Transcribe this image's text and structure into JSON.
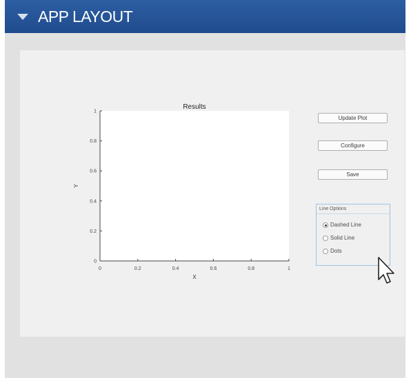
{
  "header": {
    "title": "APP LAYOUT",
    "background_color": "#1f4c8d",
    "collapse_icon": "triangle-down-icon"
  },
  "plot": {
    "title": "Results",
    "xlabel": "X",
    "ylabel": "Y",
    "xticks": [
      "0",
      "0.2",
      "0.4",
      "0.6",
      "0.8",
      "1"
    ],
    "yticks": [
      "0",
      "0.2",
      "0.4",
      "0.6",
      "0.8",
      "1"
    ]
  },
  "chart_data": {
    "type": "line",
    "title": "Results",
    "xlabel": "X",
    "ylabel": "Y",
    "xlim": [
      0,
      1
    ],
    "ylim": [
      0,
      1
    ],
    "series": [],
    "grid": false
  },
  "buttons": {
    "update_plot": "Update Plot",
    "configure": "Configure",
    "save": "Save"
  },
  "line_options": {
    "title": "Line Options",
    "options": [
      "Dashed Line",
      "Solid Line",
      "Dots"
    ],
    "selected": "Dashed Line"
  },
  "cursor": {
    "icon": "mouse-pointer-icon"
  }
}
